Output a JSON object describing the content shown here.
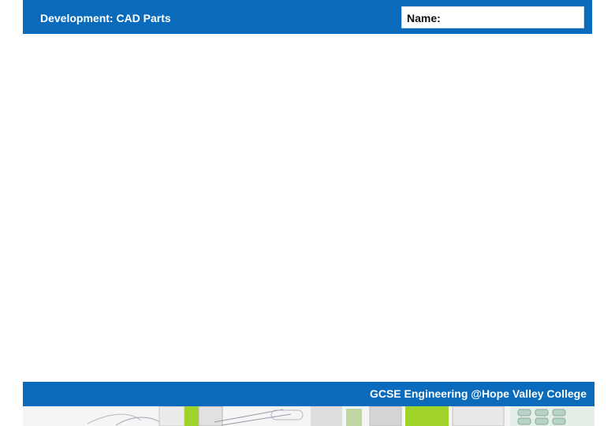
{
  "header": {
    "title": "Development: CAD Parts",
    "name_label": "Name:"
  },
  "footer": {
    "text": "GCSE Engineering @Hope Valley College"
  },
  "colors": {
    "brand_blue": "#0a6bbd",
    "sketch_green": "#9fd32a",
    "background": "#ffffff"
  },
  "decorations": {
    "sketch_strip_icon": "product-sketch-strip"
  }
}
